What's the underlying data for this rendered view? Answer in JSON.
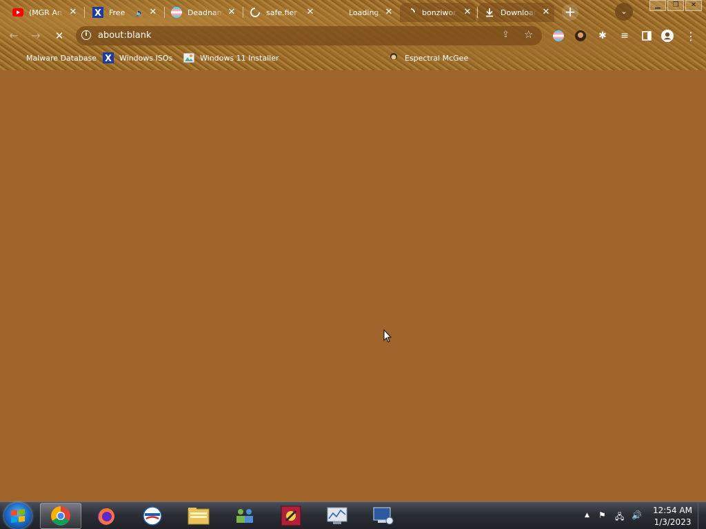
{
  "tabs": [
    {
      "title": "(MGR An",
      "icon": "youtube-icon",
      "active": false
    },
    {
      "title": "Free",
      "icon": "x-site-icon",
      "active": false,
      "audio": true
    },
    {
      "title": "Deadnam",
      "icon": "trans-flag-icon",
      "active": false
    },
    {
      "title": "safe.fier",
      "icon": "loading-spinner-icon",
      "active": false
    },
    {
      "title": "Loading...",
      "icon": "",
      "active": false
    },
    {
      "title": "bonziwor",
      "icon": "loading-spinner-icon",
      "active": true
    },
    {
      "title": "Downloac",
      "icon": "download-icon",
      "active": true
    }
  ],
  "toolbar": {
    "url": "about:blank",
    "back": "←",
    "forward": "→",
    "stop": "✕"
  },
  "bookmarks": [
    {
      "label": "Malware Database",
      "icon": "folder-icon"
    },
    {
      "label": "Windows ISOs",
      "icon": "x-site-icon"
    },
    {
      "label": "Windows 11 Installer",
      "icon": "image-icon"
    },
    {
      "label": "",
      "icon": ""
    },
    {
      "label": "Espectral McGee",
      "icon": "character-icon"
    }
  ],
  "taskbar": {
    "apps": [
      "chrome-icon",
      "firefox-icon",
      "opera-icon",
      "file-explorer-icon",
      "network-icon",
      "game-icon",
      "system-monitor-icon",
      "remote-desktop-icon"
    ]
  },
  "clock": {
    "time": "12:54 AM",
    "date": "1/3/2023"
  },
  "colors": {
    "content_bg": "#a0652a",
    "theme": "#b07a33"
  }
}
